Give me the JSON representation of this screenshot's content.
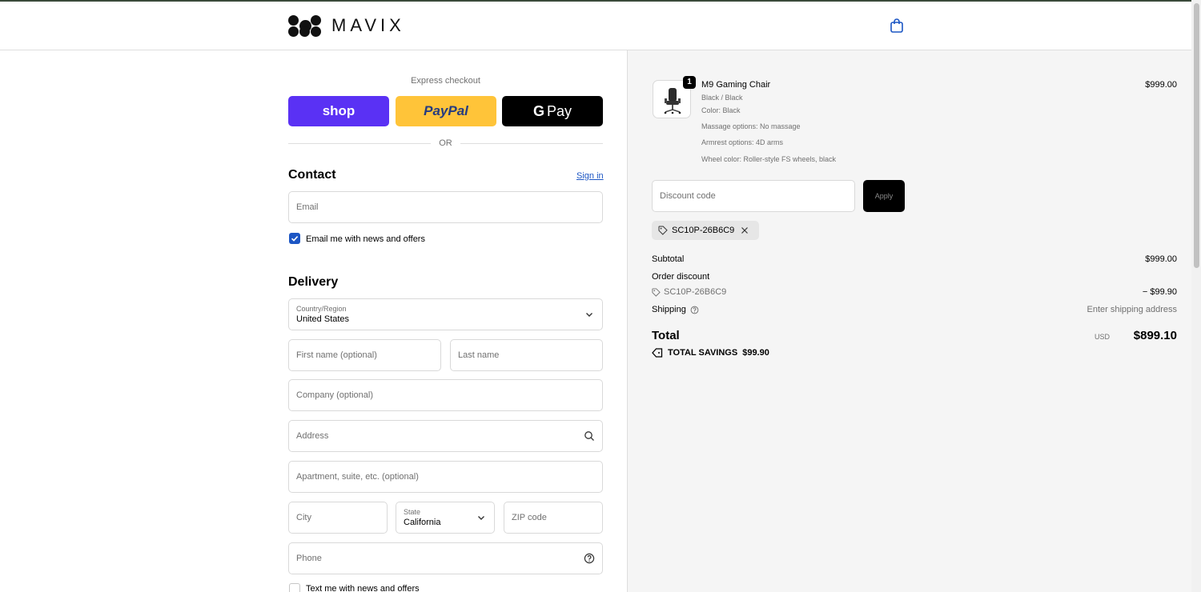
{
  "header": {
    "brand": "MAVIX",
    "cart_icon": "shopping-bag-icon"
  },
  "express": {
    "label": "Express checkout",
    "shop": "shop",
    "paypal": "PayPal",
    "gpay_g": "G",
    "gpay": "Pay",
    "or": "OR"
  },
  "contact": {
    "title": "Contact",
    "sign_in": "Sign in",
    "email_placeholder": "Email",
    "email_news": "Email me with news and offers"
  },
  "delivery": {
    "title": "Delivery",
    "country_label": "Country/Region",
    "country_value": "United States",
    "first_name": "First name (optional)",
    "last_name": "Last name",
    "company": "Company (optional)",
    "address": "Address",
    "apartment": "Apartment, suite, etc. (optional)",
    "city": "City",
    "state_label": "State",
    "state_value": "California",
    "zip": "ZIP code",
    "phone": "Phone",
    "text_news": "Text me with news and offers"
  },
  "summary": {
    "quantity": "1",
    "product_name": "M9 Gaming Chair",
    "product_price": "$999.00",
    "variant": "Black / Black",
    "details": [
      "Color: Black",
      "Massage options: No massage",
      "Armrest options: 4D arms",
      "Wheel color: Roller-style FS wheels, black"
    ],
    "discount_placeholder": "Discount code",
    "apply": "Apply",
    "applied_code": "SC10P-26B6C9",
    "subtotal_label": "Subtotal",
    "subtotal_value": "$999.00",
    "order_discount_label": "Order discount",
    "discount_code": "SC10P-26B6C9",
    "discount_value": "− $99.90",
    "shipping_label": "Shipping",
    "shipping_value": "Enter shipping address",
    "total_label": "Total",
    "currency": "USD",
    "total_value": "$899.10",
    "savings_label": "TOTAL SAVINGS",
    "savings_value": "$99.90"
  },
  "colors": {
    "shop_purple": "#5a31f4",
    "paypal_yellow": "#ffc439",
    "link_blue": "#1c56c4"
  }
}
